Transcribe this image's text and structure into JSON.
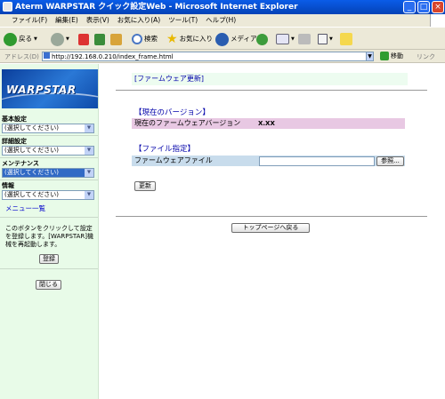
{
  "window": {
    "title": "Aterm WARPSTAR クイック設定Web - Microsoft Internet Explorer"
  },
  "menubar": [
    "ファイル(F)",
    "編集(E)",
    "表示(V)",
    "お気に入り(A)",
    "ツール(T)",
    "ヘルプ(H)"
  ],
  "toolbar": {
    "back": "戻る",
    "search": "検索",
    "favorites": "お気に入り",
    "media": "メディア"
  },
  "address": {
    "label": "アドレス(D)",
    "url": "http://192.168.0.210/index_frame.html",
    "go": "移動",
    "links": "リンク"
  },
  "sidebar": {
    "logo": "WARPSTAR",
    "groups": [
      {
        "label": "基本設定",
        "value": "(選択してください)"
      },
      {
        "label": "詳細設定",
        "value": "(選択してください)"
      },
      {
        "label": "メンテナンス",
        "value": "(選択してください)"
      },
      {
        "label": "情報",
        "value": "(選択してください)"
      }
    ],
    "menu_list": "メニュー一覧",
    "hint": "このボタンをクリックして設定を登録します。[WARPSTAR]機械を再起動します。",
    "register": "登録",
    "close": "閉じる"
  },
  "main": {
    "title": "[ファームウェア更新]",
    "current_version_heading": "【現在のバージョン】",
    "current_version_label": "現在のファームウェアバージョン",
    "current_version_value": "X.XX",
    "file_heading": "【ファイル指定】",
    "file_label": "ファームウェアファイル",
    "browse": "参照...",
    "update": "更新",
    "top_page": "トップページへ戻る"
  }
}
